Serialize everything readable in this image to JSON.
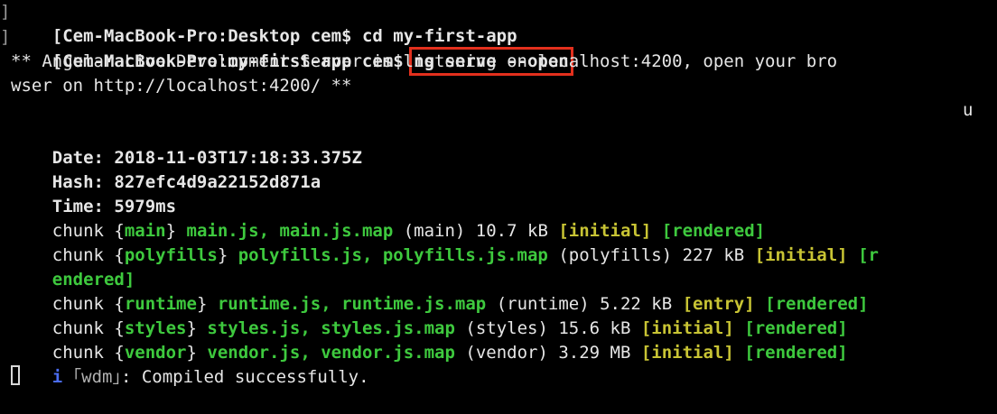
{
  "prompt1": "[Cem-MacBook-Pro:Desktop cem$ ",
  "cmd1": "cd my-first-app",
  "prompt2": "[Cem-MacBook-Pro:my-first-app cem$ ",
  "cmd2": "ng serve --open",
  "bracket_right": "]",
  "server_line1": "** Angular Live Development Server is listening on localhost:4200, open your bro",
  "server_line2": "wser on http://localhost:4200/ **",
  "stray": "u",
  "date_label": "Date: ",
  "date_value": "2018-11-03T17:18:33.375Z",
  "hash_label": "Hash: ",
  "hash_value": "827efc4d9a22152d871a",
  "time_label": "Time: ",
  "time_value": "5979ms",
  "chunks": [
    {
      "word": "chunk ",
      "open": "{",
      "name": "main",
      "close": "} ",
      "files": "main.js, main.js.map",
      "meta": " (main) 10.7 kB ",
      "tag1": "[initial]",
      "sp": " ",
      "tag2": "[rendered]"
    },
    {
      "word": "chunk ",
      "open": "{",
      "name": "polyfills",
      "close": "} ",
      "files": "polyfills.js, polyfills.js.map",
      "meta": " (polyfills) 227 kB ",
      "tag1": "[initial]",
      "sp": " ",
      "tag2": "[r",
      "tag2b": "endered]"
    },
    {
      "word": "chunk ",
      "open": "{",
      "name": "runtime",
      "close": "} ",
      "files": "runtime.js, runtime.js.map",
      "meta": " (runtime) 5.22 kB ",
      "tag1": "[entry]",
      "sp": " ",
      "tag2": "[rendered]"
    },
    {
      "word": "chunk ",
      "open": "{",
      "name": "styles",
      "close": "} ",
      "files": "styles.js, styles.js.map",
      "meta": " (styles) 15.6 kB ",
      "tag1": "[initial]",
      "sp": " ",
      "tag2": "[rendered]"
    },
    {
      "word": "chunk ",
      "open": "{",
      "name": "vendor",
      "close": "} ",
      "files": "vendor.js, vendor.js.map",
      "meta": " (vendor) 3.29 MB ",
      "tag1": "[initial]",
      "sp": " ",
      "tag2": "[rendered]"
    }
  ],
  "wdm_icon": "i",
  "wdm_tag": " ｢wdm｣",
  "wdm_msg": ": Compiled successfully."
}
